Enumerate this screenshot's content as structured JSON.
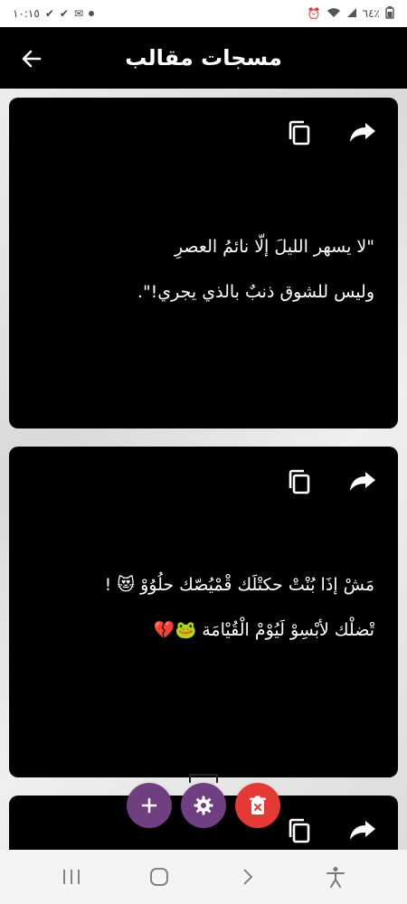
{
  "status_bar": {
    "time": "١٠:١٥",
    "battery": "٦٤٪"
  },
  "app_bar": {
    "title": "مسجات مقالب"
  },
  "cards": [
    {
      "line1": "\"لا يسهر الليلَ إلّا نائمُ العصرِ",
      "line2": "وليس للشوق ذنبٌ بالذي يجري!\"."
    },
    {
      "line1": "مَشْ إذَا بُنْتْ حكتْلَك قْمْيُصّك حلُوُوْ 😻 !",
      "line2": "تْضلْك لأبْسِوْ لَيُوْمْ الْقُيْامَة 🐸💔"
    },
    {
      "line1": "",
      "line2": ""
    }
  ],
  "colors": {
    "app_bar": "#000000",
    "card": "#000000",
    "fab_primary": "#6f3f82",
    "fab_delete": "#e53935"
  },
  "icons": {
    "back": "arrow-left-icon",
    "copy": "copy-icon",
    "share": "share-icon",
    "add": "plus-icon",
    "settings": "gear-icon",
    "delete": "trash-icon"
  }
}
